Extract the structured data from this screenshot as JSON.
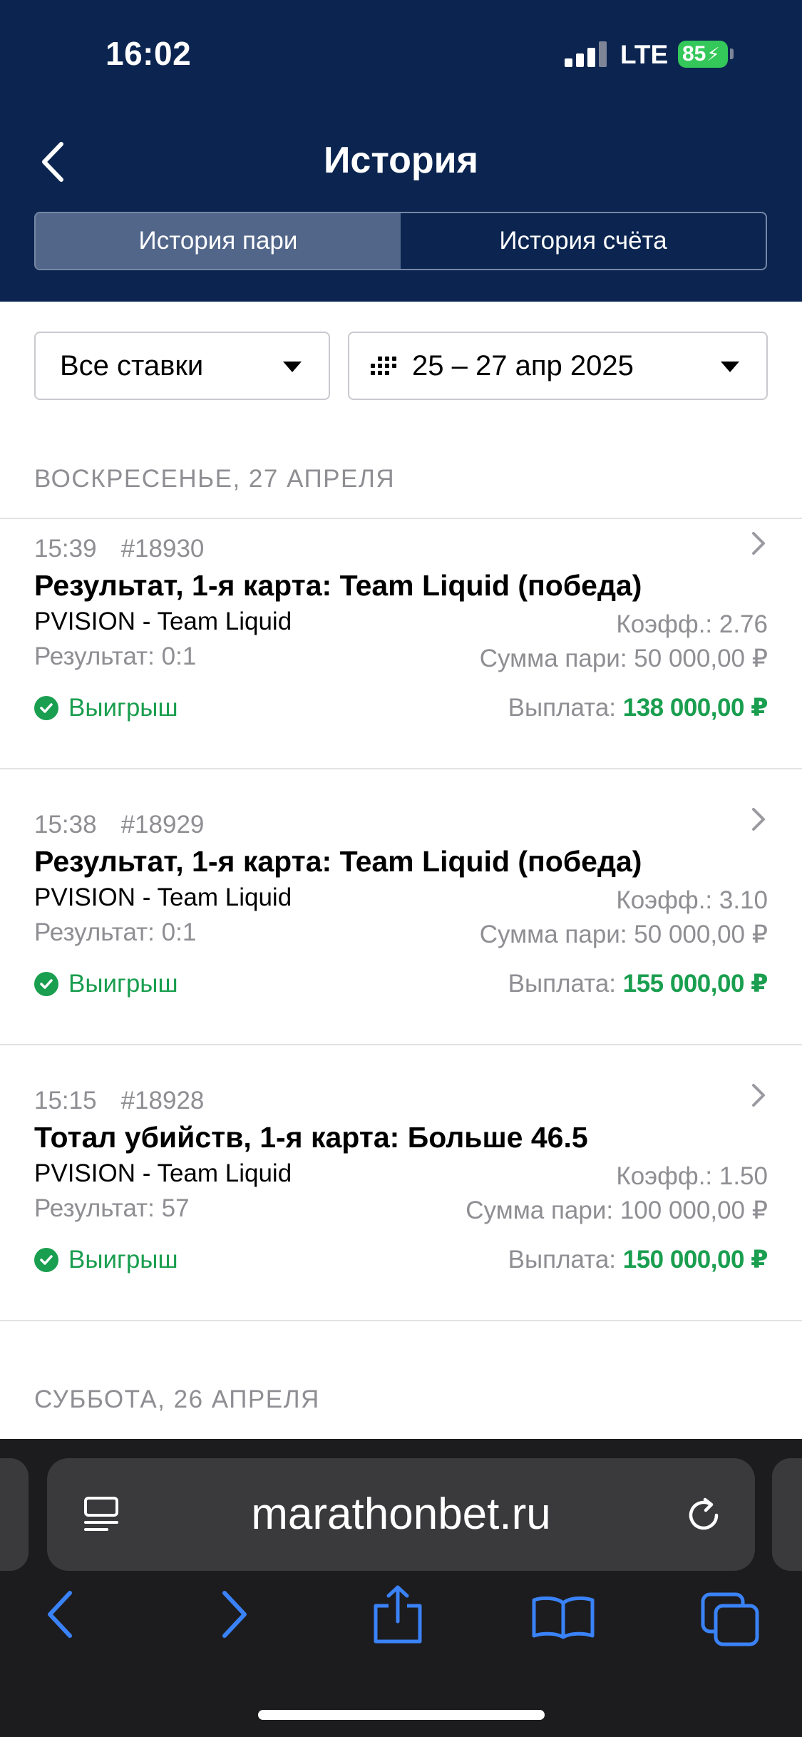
{
  "status_bar": {
    "time": "16:02",
    "network": "LTE",
    "battery": "85"
  },
  "header": {
    "title": "История",
    "tabs": [
      {
        "label": "История пари",
        "active": true
      },
      {
        "label": "История счёта",
        "active": false
      }
    ]
  },
  "filters": {
    "type": "Все ставки",
    "date_range": "25 – 27 апр 2025"
  },
  "sections": [
    {
      "label": "ВОСКРЕСЕНЬЕ, 27 АПРЕЛЯ",
      "bets": [
        {
          "time": "15:39",
          "id": "#18930",
          "title": "Результат, 1-я карта: Team Liquid (победа)",
          "match": "PVISION - Team Liquid",
          "result": "Результат: 0:1",
          "coef": "Коэфф.: 2.76",
          "stake": "Сумма пари: 50 000,00 ₽",
          "status": "Выигрыш",
          "payout_label": "Выплата:",
          "payout": "138 000,00 ₽"
        },
        {
          "time": "15:38",
          "id": "#18929",
          "title": "Результат, 1-я карта: Team Liquid (победа)",
          "match": "PVISION - Team Liquid",
          "result": "Результат: 0:1",
          "coef": "Коэфф.: 3.10",
          "stake": "Сумма пари: 50 000,00 ₽",
          "status": "Выигрыш",
          "payout_label": "Выплата:",
          "payout": "155 000,00 ₽"
        },
        {
          "time": "15:15",
          "id": "#18928",
          "title": "Тотал убийств, 1-я карта: Больше 46.5",
          "match": "PVISION - Team Liquid",
          "result": "Результат: 57",
          "coef": "Коэфф.: 1.50",
          "stake": "Сумма пари: 100 000,00 ₽",
          "status": "Выигрыш",
          "payout_label": "Выплата:",
          "payout": "150 000,00 ₽"
        }
      ]
    },
    {
      "label": "СУББОТА, 26 АПРЕЛЯ",
      "bets": []
    }
  ],
  "browser": {
    "url": "marathonbet.ru"
  },
  "icons": {
    "back": "chevron-left-icon",
    "dropdown": "caret-down-icon",
    "calendar": "calendar-icon",
    "win": "check-circle-icon",
    "reader": "reader-icon",
    "reload": "reload-icon",
    "nav_back": "back-arrow-icon",
    "nav_forward": "forward-arrow-icon",
    "share": "share-icon",
    "bookmarks": "book-icon",
    "tabs": "tabs-icon"
  },
  "colors": {
    "header_bg": "#0b2550",
    "active_tab": "#52668a",
    "win_green": "#1a9e4f",
    "safari_blue": "#3a82f7"
  }
}
